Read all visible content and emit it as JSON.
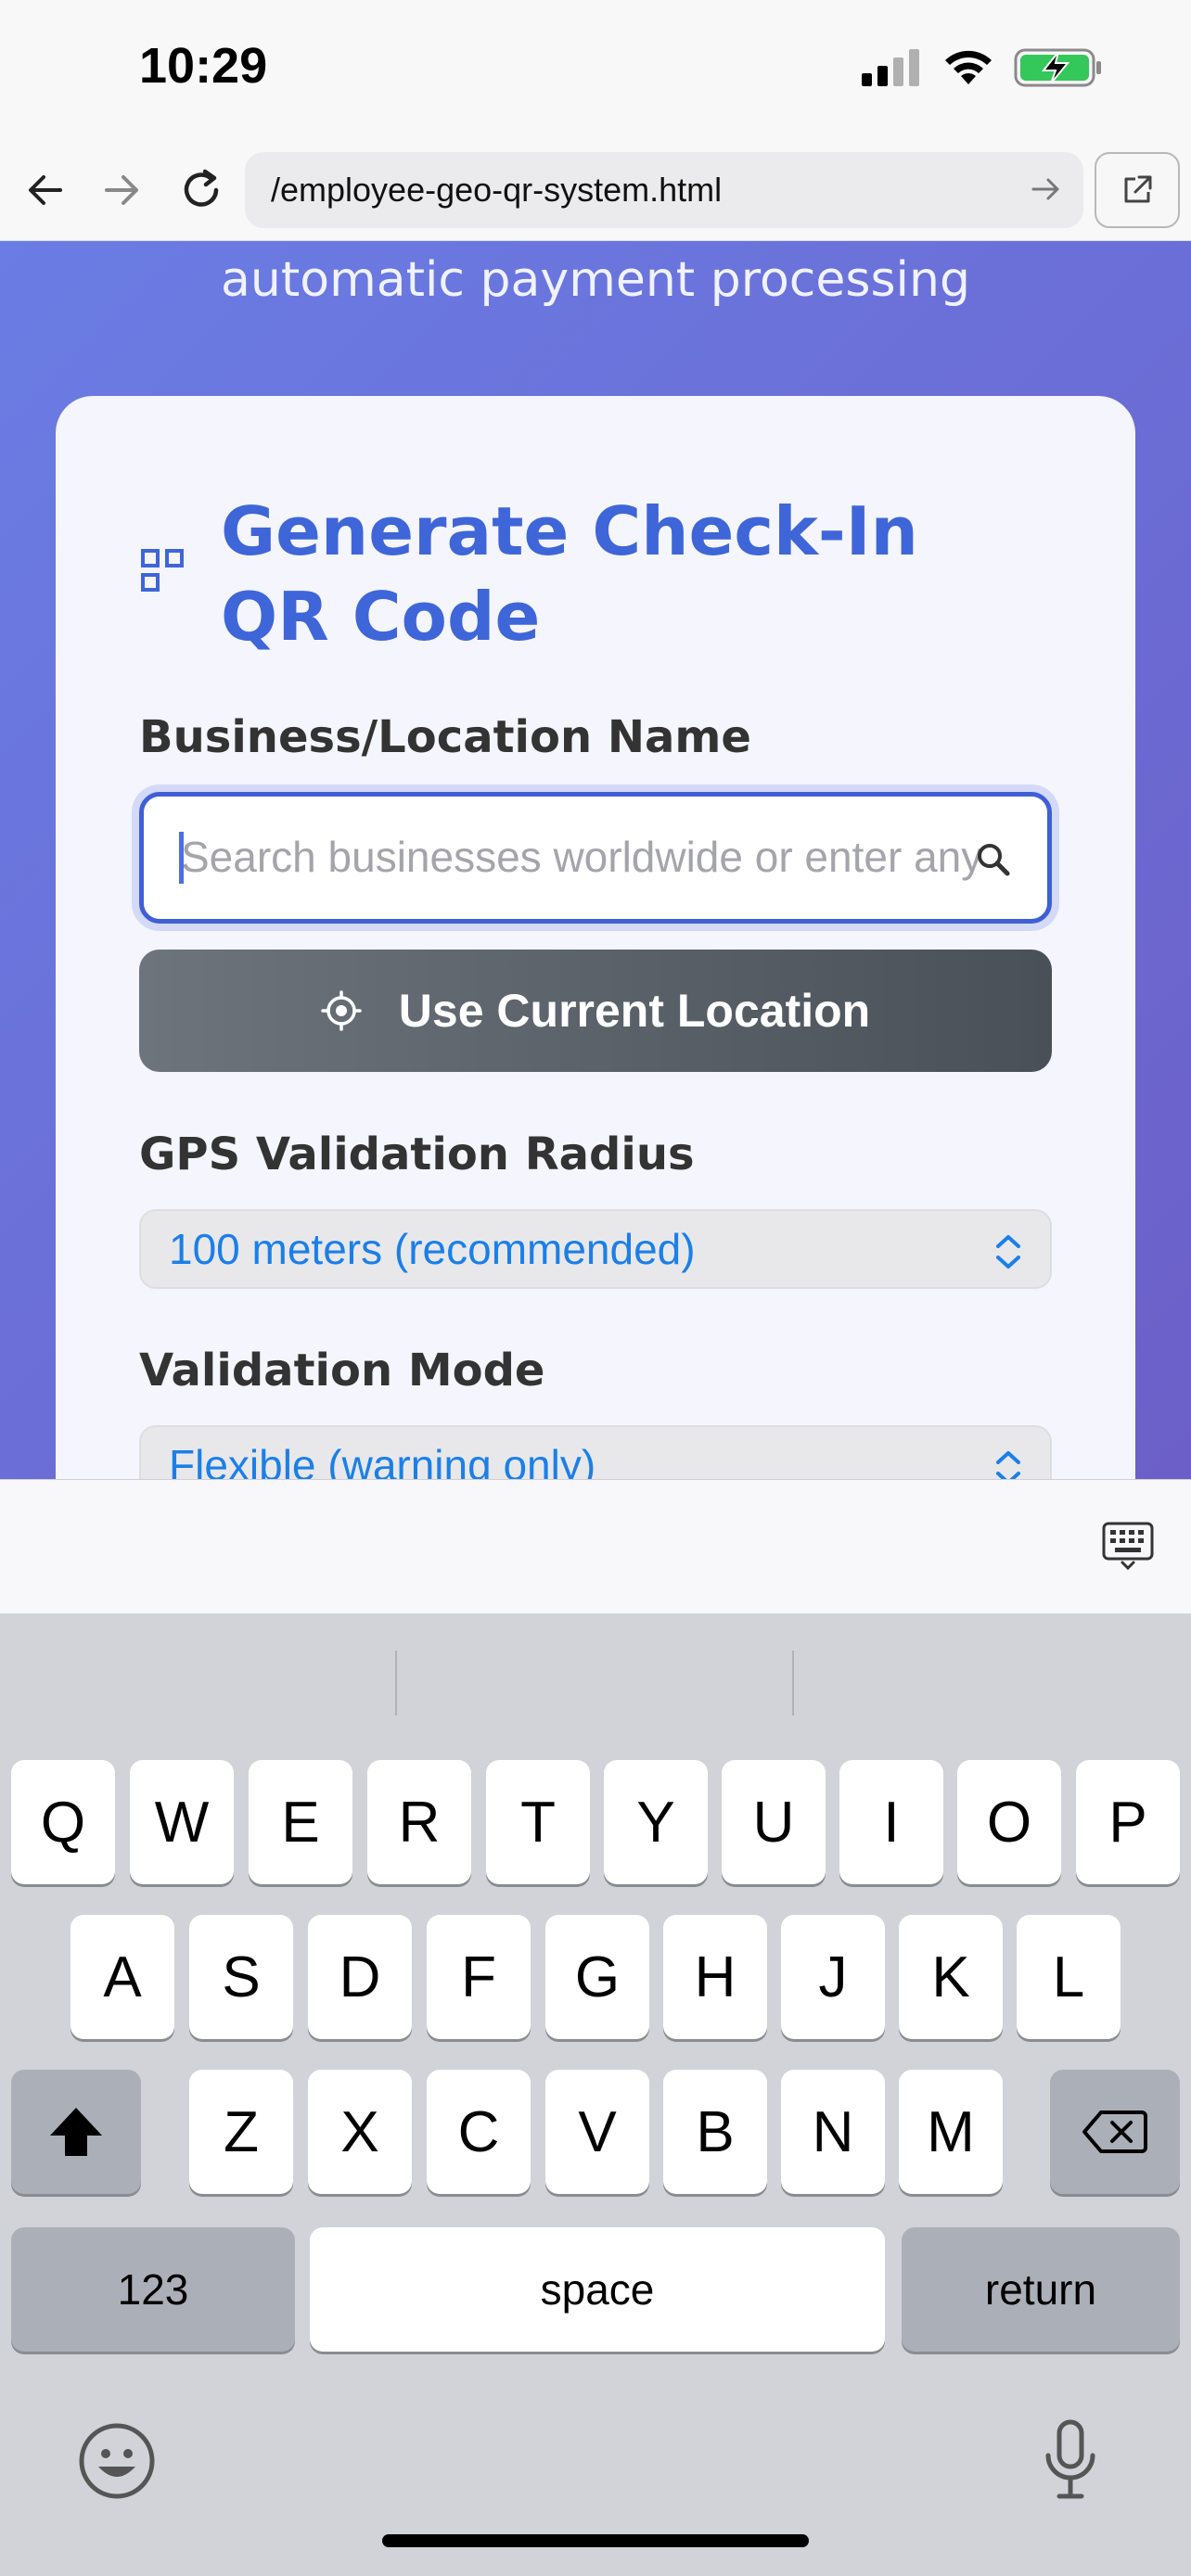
{
  "status_bar": {
    "time": "10:29"
  },
  "browser": {
    "url": "/employee-geo-qr-system.html"
  },
  "page": {
    "subtitle": "automatic payment processing",
    "card": {
      "title": "Generate Check-In QR Code",
      "business_label": "Business/Location Name",
      "search_placeholder": "Search businesses worldwide or enter any",
      "use_location_label": "Use Current Location",
      "radius_label": "GPS Validation Radius",
      "radius_value": "100 meters (recommended)",
      "mode_label": "Validation Mode",
      "mode_value": "Flexible (warning only)"
    },
    "accent_color": "#3f66d8",
    "background_gradient": [
      "#6a7de4",
      "#6c5fc8"
    ]
  },
  "keyboard": {
    "row1": [
      "Q",
      "W",
      "E",
      "R",
      "T",
      "Y",
      "U",
      "I",
      "O",
      "P"
    ],
    "row2": [
      "A",
      "S",
      "D",
      "F",
      "G",
      "H",
      "J",
      "K",
      "L"
    ],
    "row3": [
      "Z",
      "X",
      "C",
      "V",
      "B",
      "N",
      "M"
    ],
    "numbers_label": "123",
    "space_label": "space",
    "return_label": "return"
  }
}
